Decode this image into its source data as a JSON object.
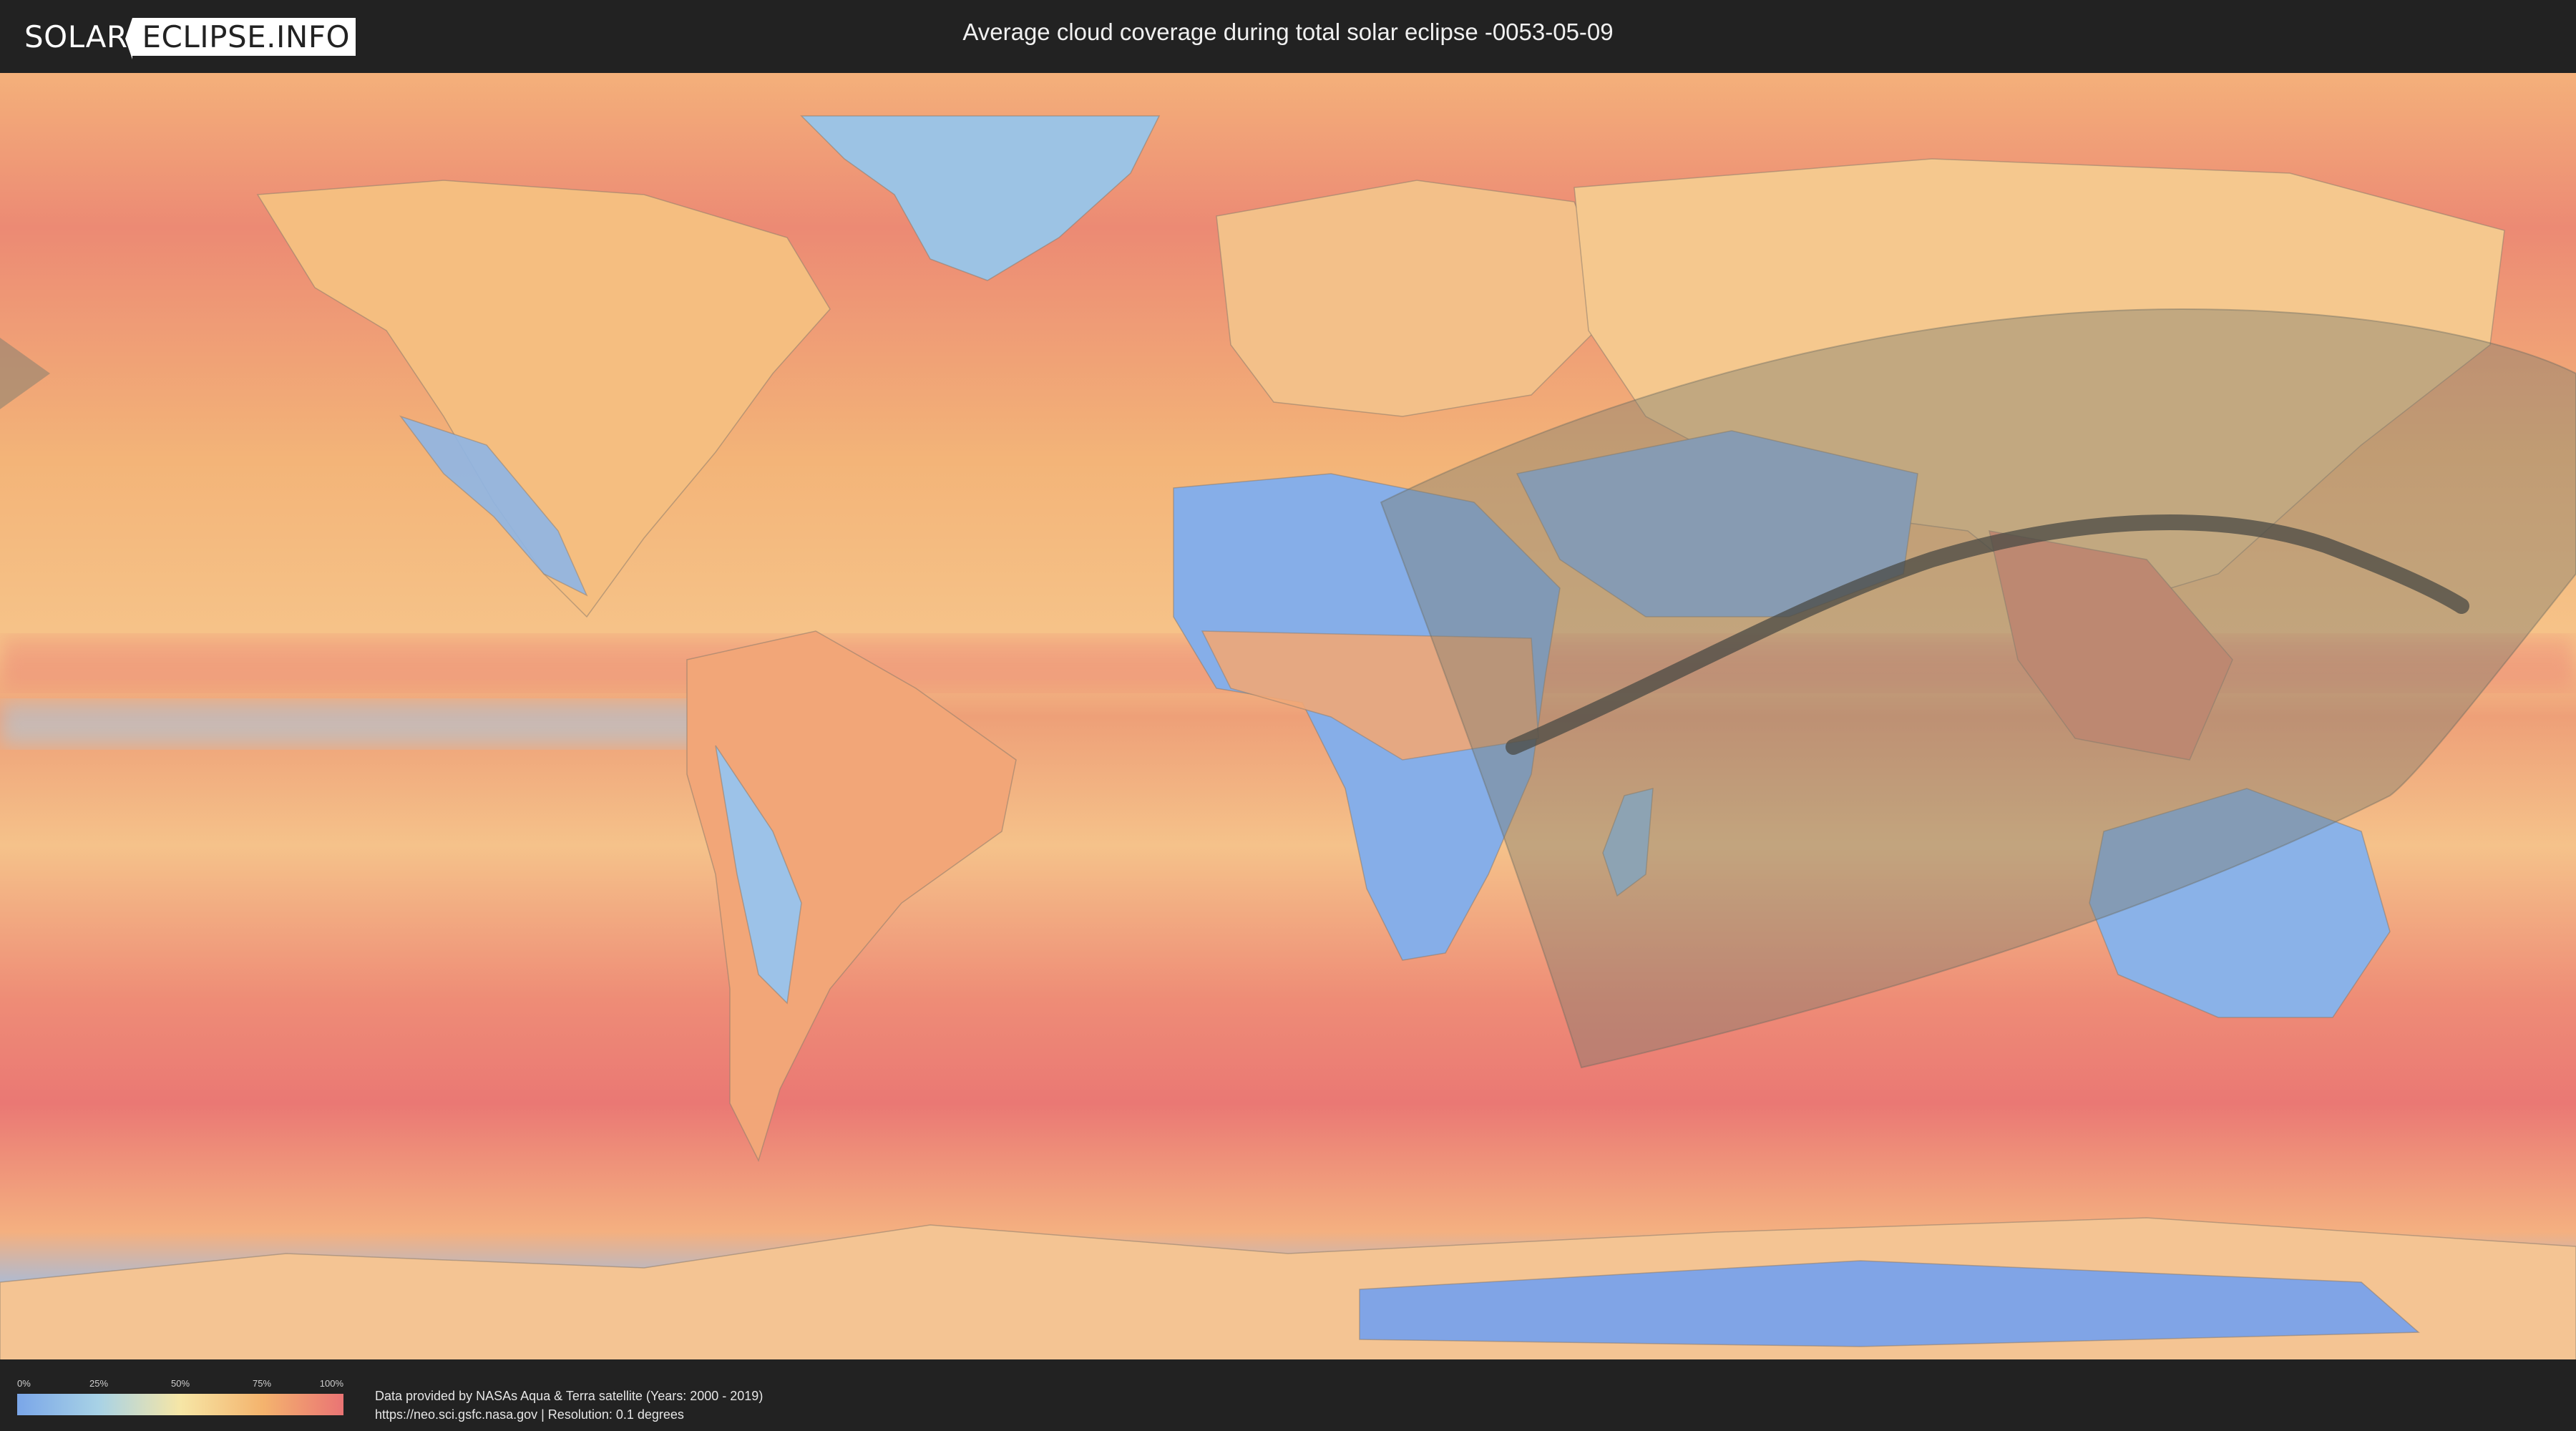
{
  "header": {
    "logo_part1": "SOLAR",
    "logo_part2": "ECLIPSE.INFO",
    "title": "Average cloud coverage during total solar eclipse -0053-05-09"
  },
  "map": {
    "layer": "average cloud coverage",
    "visibility_zone": "eclipse visibility region (shaded)",
    "totality_path": "path of totality (dark band)"
  },
  "legend": {
    "ticks": [
      "0%",
      "25%",
      "50%",
      "75%",
      "100%"
    ],
    "colors": [
      "#7aa6e8",
      "#a8d2e6",
      "#f6e6a6",
      "#f4b46e",
      "#ea7474"
    ]
  },
  "footer": {
    "credit_line1": "Data provided by NASAs Aqua & Terra satellite (Years: 2000 - 2019)",
    "credit_line2": "https://neo.sci.gsfc.nasa.gov | Resolution: 0.1 degrees"
  }
}
